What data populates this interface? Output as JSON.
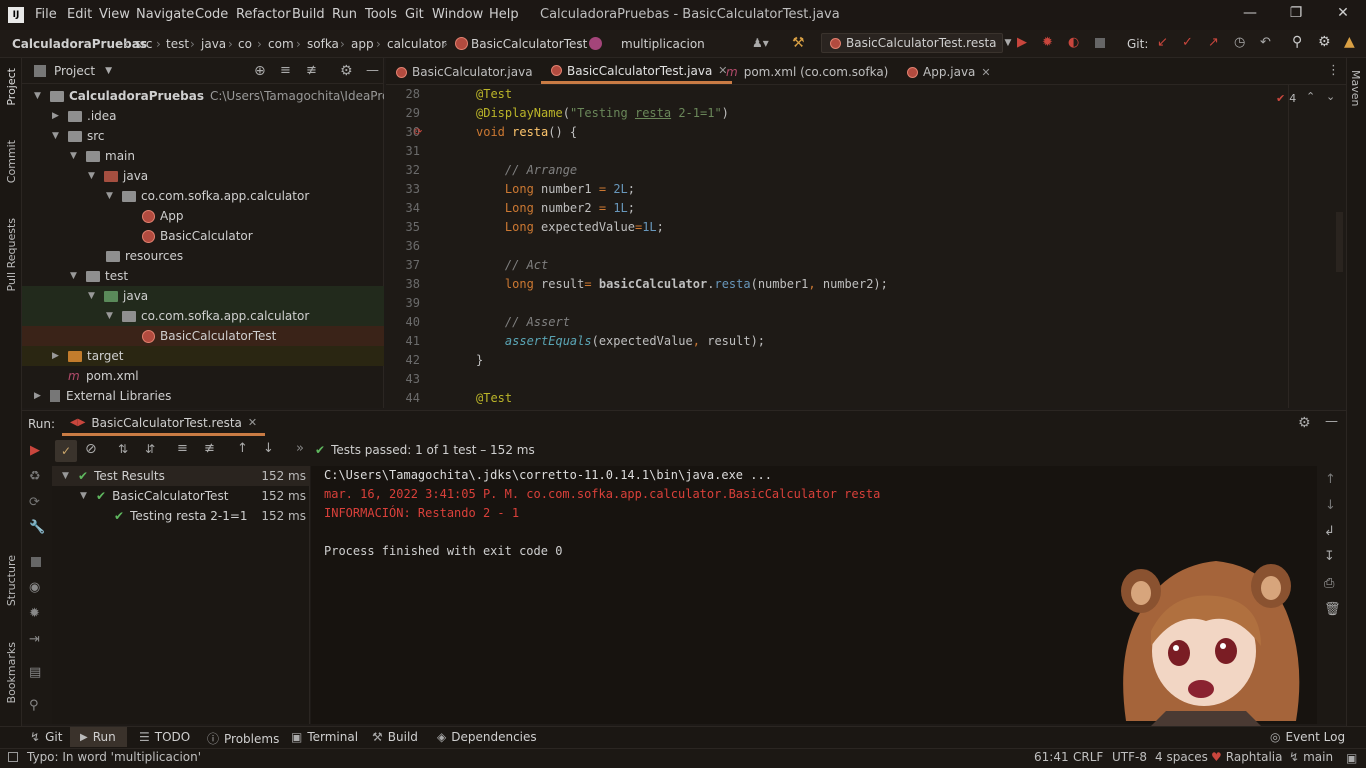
{
  "window": {
    "title": "CalculadoraPruebas - BasicCalculatorTest.java",
    "menu": [
      "File",
      "Edit",
      "View",
      "Navigate",
      "Code",
      "Refactor",
      "Build",
      "Run",
      "Tools",
      "Git",
      "Window",
      "Help"
    ]
  },
  "breadcrumb": [
    "CalculadoraPruebas",
    "src",
    "test",
    "java",
    "co",
    "com",
    "sofka",
    "app",
    "calculator",
    "BasicCalculatorTest",
    "multiplicacion"
  ],
  "toolbar": {
    "run_config": "BasicCalculatorTest.resta",
    "git_label": "Git:"
  },
  "sidebar_left": {
    "project": "Project",
    "commit": "Commit",
    "pull_requests": "Pull Requests",
    "structure": "Structure",
    "bookmarks": "Bookmarks"
  },
  "sidebar_right": {
    "maven": "Maven"
  },
  "project_panel": {
    "title": "Project",
    "root_name": "CalculadoraPruebas",
    "root_path": "C:\\Users\\Tamagochita\\IdeaProjects\\Ca",
    "items": [
      {
        "label": ".idea"
      },
      {
        "label": "src"
      },
      {
        "label": "main"
      },
      {
        "label": "java"
      },
      {
        "label": "co.com.sofka.app.calculator"
      },
      {
        "label": "App"
      },
      {
        "label": "BasicCalculator"
      },
      {
        "label": "resources"
      },
      {
        "label": "test"
      },
      {
        "label": "java"
      },
      {
        "label": "co.com.sofka.app.calculator"
      },
      {
        "label": "BasicCalculatorTest"
      },
      {
        "label": "target"
      },
      {
        "label": "pom.xml"
      },
      {
        "label": "External Libraries"
      }
    ]
  },
  "editor": {
    "tabs": [
      {
        "label": "BasicCalculator.java"
      },
      {
        "label": "BasicCalculatorTest.java"
      },
      {
        "label": "pom.xml (co.com.sofka)"
      },
      {
        "label": "App.java"
      }
    ],
    "warnings_count": "4",
    "line_numbers": [
      "28",
      "29",
      "30",
      "31",
      "32",
      "33",
      "34",
      "35",
      "36",
      "37",
      "38",
      "39",
      "40",
      "41",
      "42",
      "43",
      "44"
    ]
  },
  "run_panel": {
    "label": "Run:",
    "tab": "BasicCalculatorTest.resta",
    "status": "Tests passed: 1 of 1 test – 152 ms",
    "tree": [
      {
        "label": "Test Results",
        "time": "152 ms"
      },
      {
        "label": "BasicCalculatorTest",
        "time": "152 ms"
      },
      {
        "label": "Testing resta 2-1=1",
        "time": "152 ms"
      }
    ],
    "console": {
      "line1": "C:\\Users\\Tamagochita\\.jdks\\corretto-11.0.14.1\\bin\\java.exe ...",
      "line2": "mar. 16, 2022 3:41:05 P. M. co.com.sofka.app.calculator.BasicCalculator resta",
      "line3": "INFORMACIÓN: Restando 2 - 1",
      "line4": "Process finished with exit code 0"
    }
  },
  "bottom_tabs": [
    "Git",
    "Run",
    "TODO",
    "Problems",
    "Terminal",
    "Build",
    "Dependencies"
  ],
  "event_log": "Event Log",
  "status_bar": {
    "message": "Typo: In word 'multiplicacion'",
    "position": "61:41",
    "line_sep": "CRLF",
    "encoding": "UTF-8",
    "indent": "4 spaces",
    "theme": "Raphtalia",
    "branch": "main"
  }
}
